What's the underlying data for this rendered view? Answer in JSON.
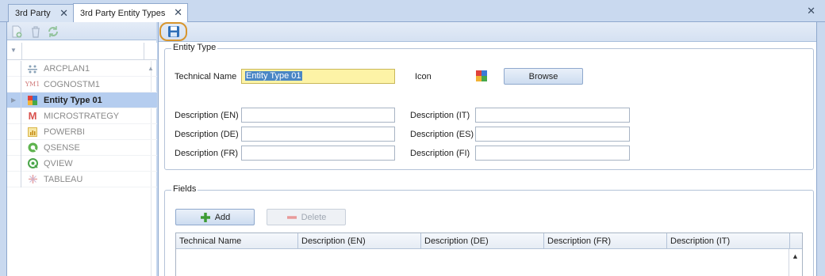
{
  "tabs": [
    {
      "label": "3rd Party",
      "active": false
    },
    {
      "label": "3rd Party Entity Types",
      "active": true
    }
  ],
  "close_glyph": "✕",
  "left_panel": {
    "toolbar_icons": [
      "add-document-icon",
      "trash-icon",
      "refresh-icon"
    ],
    "items": [
      {
        "label": "ARCPLAN1",
        "icon": "arcplan-icon",
        "selected": false
      },
      {
        "label": "COGNOSTM1",
        "icon": "cognos-icon",
        "selected": false
      },
      {
        "label": "Entity Type 01",
        "icon": "puzzle-icon",
        "selected": true
      },
      {
        "label": "MICROSTRATEGY",
        "icon": "microstrategy-icon",
        "selected": false
      },
      {
        "label": "POWERBI",
        "icon": "powerbi-icon",
        "selected": false
      },
      {
        "label": "QSENSE",
        "icon": "qsense-icon",
        "selected": false
      },
      {
        "label": "QVIEW",
        "icon": "qview-icon",
        "selected": false
      },
      {
        "label": "TABLEAU",
        "icon": "tableau-icon",
        "selected": false
      }
    ]
  },
  "entity_type": {
    "group_title": "Entity Type",
    "technical_name_label": "Technical Name",
    "technical_name_value": "Entity Type 01",
    "icon_label": "Icon",
    "browse_label": "Browse",
    "desc_en_label": "Description (EN)",
    "desc_de_label": "Description (DE)",
    "desc_fr_label": "Description (FR)",
    "desc_it_label": "Description (IT)",
    "desc_es_label": "Description (ES)",
    "desc_fi_label": "Description (FI)"
  },
  "fields": {
    "group_title": "Fields",
    "add_label": "Add",
    "delete_label": "Delete",
    "columns": [
      "Technical Name",
      "Description (EN)",
      "Description (DE)",
      "Description (FR)",
      "Description (IT)"
    ]
  },
  "colors": {
    "selection": "#b5cdef",
    "focus_field": "#fdf3a6",
    "save_highlight": "#d7952d"
  }
}
